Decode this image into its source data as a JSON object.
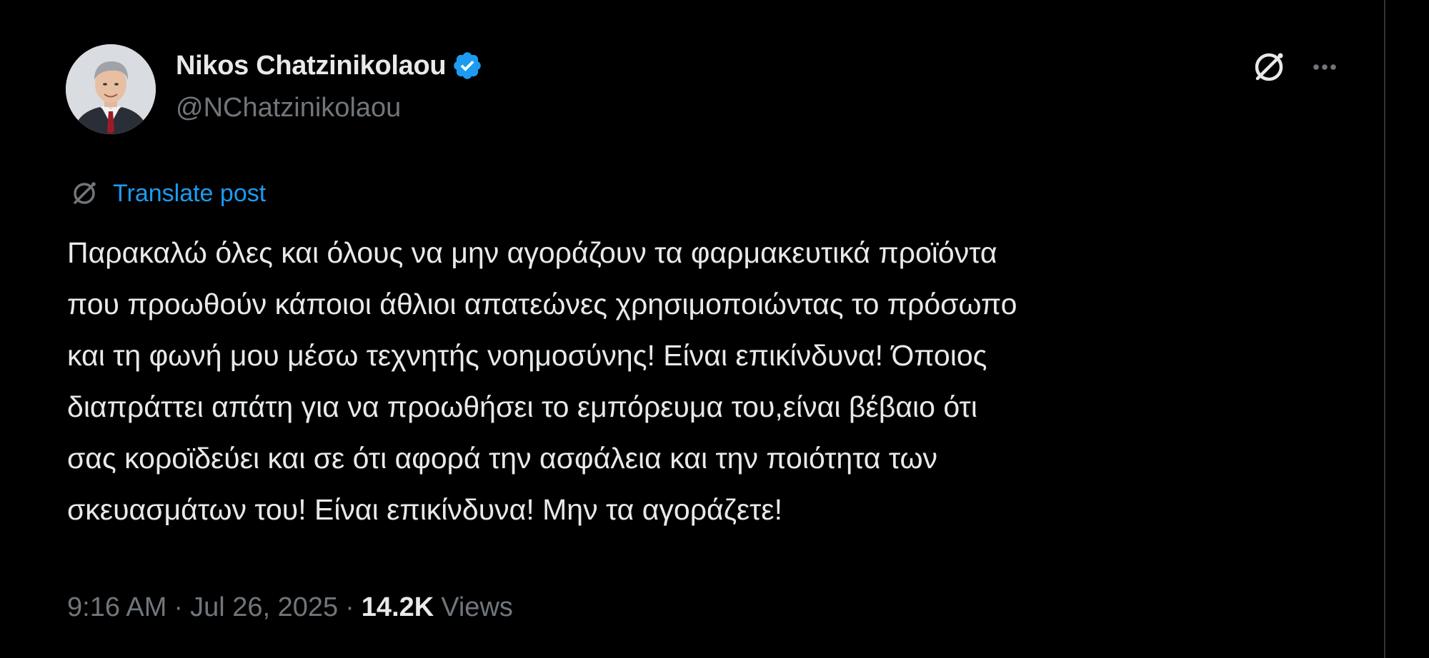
{
  "post": {
    "author": {
      "display_name": "Nikos Chatzinikolaou",
      "handle": "@NChatzinikolaou",
      "verified_icon": "verified-badge-icon",
      "avatar": "avatar-photo"
    },
    "header_actions": {
      "grok_icon": "grok-icon",
      "more_icon": "more-icon"
    },
    "translate_label": "Translate post",
    "text_lines": [
      "Παρακαλώ όλες και όλους να μην αγοράζουν τα φαρμακευτικά προϊόντα",
      "που προωθούν κάποιοι άθλιοι απατεώνες χρησιμοποιώντας το πρόσωπο",
      "και τη φωνή μου μέσω τεχνητής νοημοσύνης! Είναι επικίνδυνα! Όποιος",
      "διαπράττει απάτη για να προωθήσει το εμπόρευμα του,είναι βέβαιο ότι",
      "σας κοροϊδεύει και σε ότι αφορά την ασφάλεια και την ποιότητα των",
      "σκευασμάτων του! Είναι επικίνδυνα! Μην τα αγοράζετε!"
    ],
    "meta": {
      "time": "9:16 AM",
      "separator": "·",
      "date": "Jul 26, 2025",
      "views_count": "14.2K",
      "views_label": "Views"
    }
  },
  "colors": {
    "background": "#000000",
    "text_primary": "#e7e9ea",
    "text_secondary": "#71767b",
    "accent": "#1d9bf0",
    "divider": "#2f3336"
  }
}
